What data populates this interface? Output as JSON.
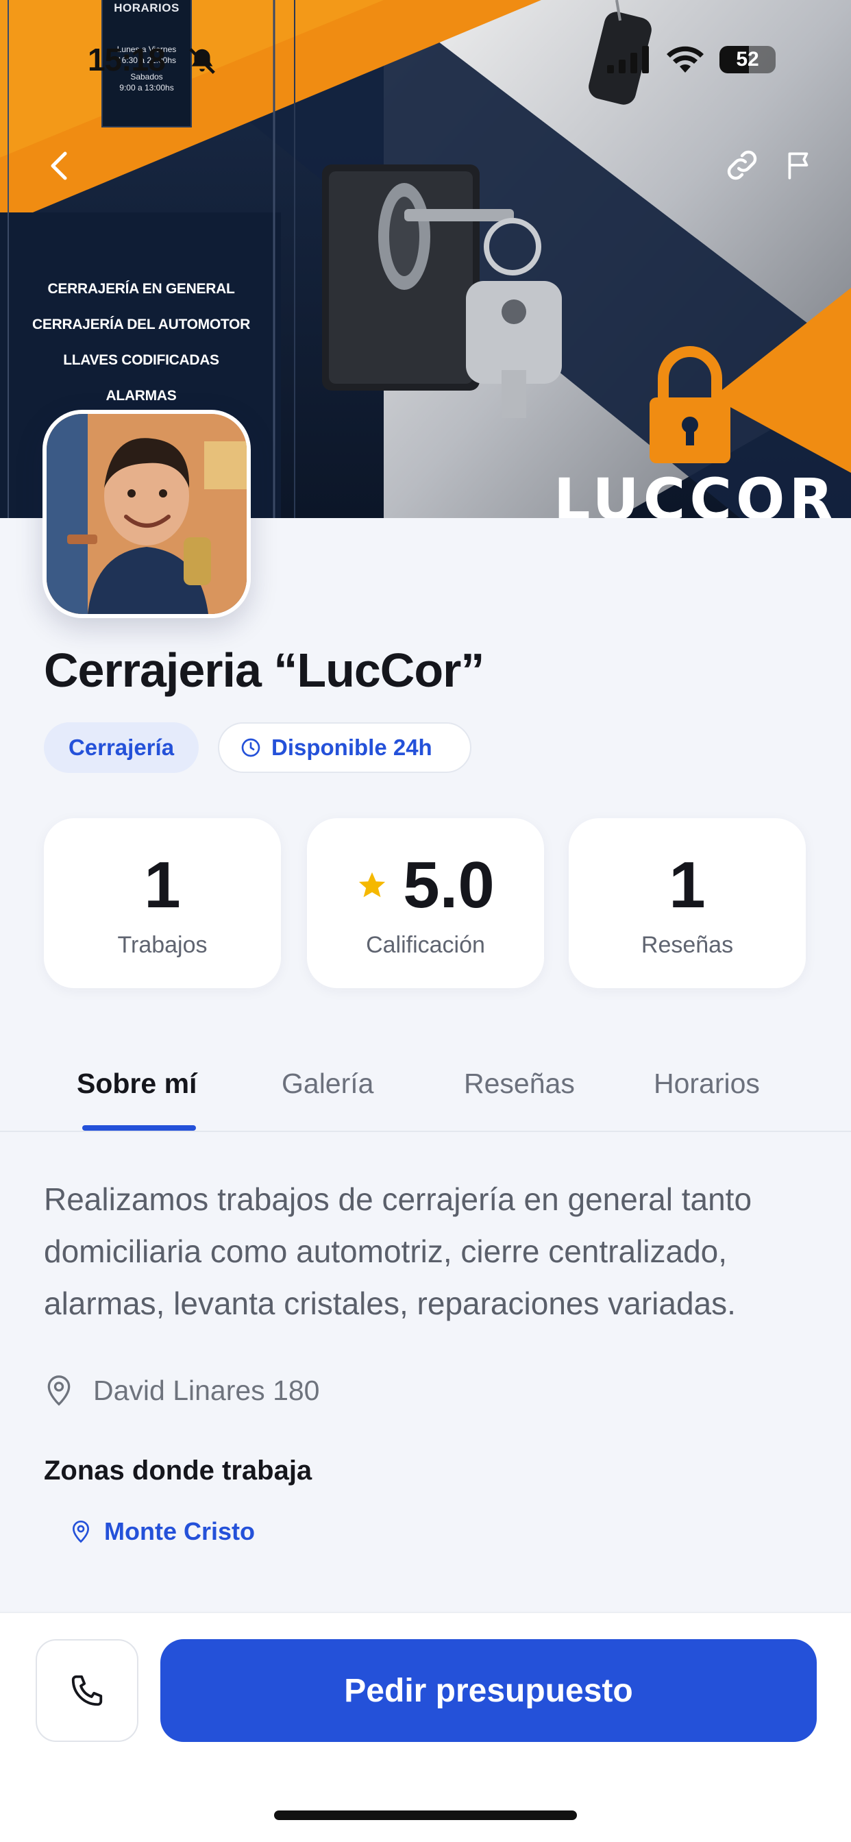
{
  "status_bar": {
    "time": "15:18",
    "battery": "52"
  },
  "hero": {
    "hours_title": "HORARIOS",
    "hours_lines": [
      "Lunes a Viernes",
      "16:30 a 21:00hs",
      "Sabados",
      "9:00 a 13:00hs"
    ],
    "services": [
      "CERRAJERÍA EN GENERAL",
      "CERRAJERÍA DEL AUTOMOTOR",
      "LLAVES CODIFICADAS",
      "ALARMAS"
    ],
    "brand": "LUCCOR"
  },
  "profile": {
    "name": "Cerrajeria “LucCor”",
    "category": "Cerrajería",
    "availability": "Disponible 24h"
  },
  "stats": [
    {
      "value": "1",
      "label": "Trabajos"
    },
    {
      "value": "5.0",
      "label": "Calificación"
    },
    {
      "value": "1",
      "label": "Reseñas"
    }
  ],
  "tabs": [
    "Sobre mí",
    "Galería",
    "Reseñas",
    "Horarios"
  ],
  "about": {
    "description": "Realizamos trabajos de cerrajería en general tanto domiciliaria como automotriz, cierre centralizado, alarmas, levanta cristales, reparaciones variadas.",
    "address": "David Linares 180",
    "zones_title": "Zonas donde trabaja",
    "zones": [
      "Monte Cristo"
    ]
  },
  "actions": {
    "cta": "Pedir presupuesto"
  },
  "colors": {
    "accent": "#2451d9",
    "star": "#f5b800",
    "banner_orange": "#f08c12",
    "banner_navy": "#13233f"
  }
}
